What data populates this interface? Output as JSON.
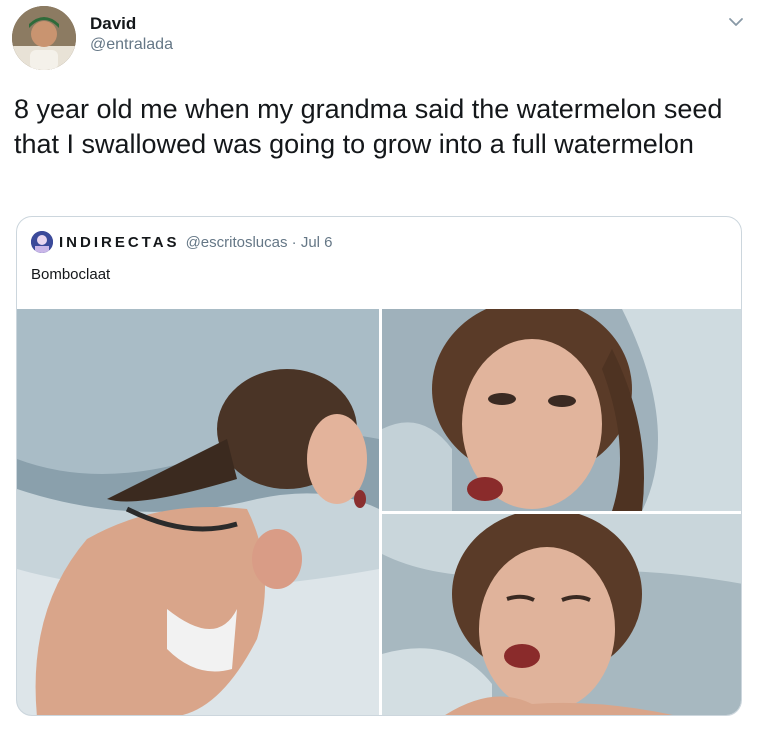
{
  "tweet": {
    "display_name": "David",
    "handle": "@entralada",
    "text": "8 year old me when my grandma said the watermelon seed that I swallowed was going to grow into a full watermelon"
  },
  "quoted_tweet": {
    "display_name": "INDIRECTAS",
    "meta": "@escritoslucas · Jul 6",
    "text": "Bomboclaat"
  },
  "icons": {
    "more": "chevron-down-icon"
  },
  "colors": {
    "text": "#14171a",
    "secondary": "#657786",
    "border": "#ccd6dd"
  }
}
